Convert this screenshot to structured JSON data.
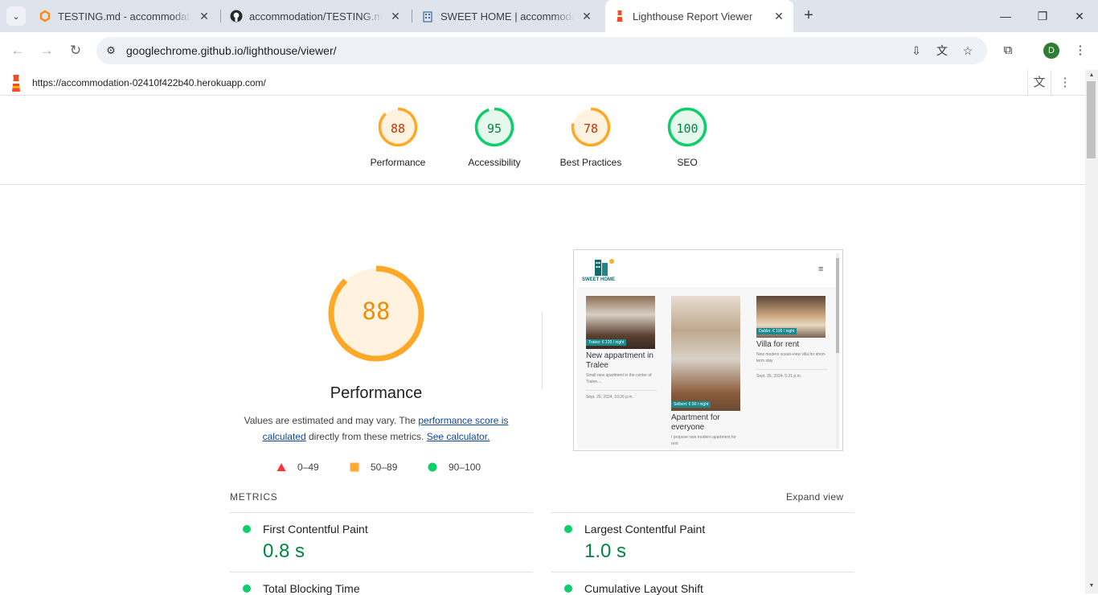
{
  "browser": {
    "tabs": [
      {
        "title": "TESTING.md - accommodation",
        "favicon": "gitpod-icon",
        "active": false
      },
      {
        "title": "accommodation/TESTING.md at",
        "favicon": "github-icon",
        "active": false
      },
      {
        "title": "SWEET HOME | accommodation",
        "favicon": "building-icon",
        "active": false
      },
      {
        "title": "Lighthouse Report Viewer",
        "favicon": "lighthouse-icon",
        "active": true
      }
    ],
    "url": "googlechrome.github.io/lighthouse/viewer/",
    "profile_initial": "D",
    "accent": "#dfe3ec"
  },
  "report": {
    "tested_url": "https://accommodation-02410f422b40.herokuapp.com/",
    "categories": [
      {
        "label": "Performance",
        "score": "88",
        "status": "average"
      },
      {
        "label": "Accessibility",
        "score": "95",
        "status": "pass"
      },
      {
        "label": "Best Practices",
        "score": "78",
        "status": "average"
      },
      {
        "label": "SEO",
        "score": "100",
        "status": "pass"
      }
    ],
    "performance": {
      "score": "88",
      "title": "Performance",
      "desc_before": "Values are estimated and may vary. The ",
      "desc_link": "performance score is calculated",
      "desc_middle": " directly from these metrics. ",
      "desc_calc": "See calculator."
    },
    "legend": [
      {
        "range": "0–49",
        "shape": "triangle",
        "color": "#ff3333"
      },
      {
        "range": "50–89",
        "shape": "square",
        "color": "#ffaa33"
      },
      {
        "range": "90–100",
        "shape": "circle",
        "color": "#0cce6b"
      }
    ],
    "metrics_heading": "METRICS",
    "expand_label": "Expand view",
    "metrics": [
      {
        "name": "First Contentful Paint",
        "value": "0.8 s"
      },
      {
        "name": "Largest Contentful Paint",
        "value": "1.0 s"
      },
      {
        "name": "Total Blocking Time",
        "value": ""
      },
      {
        "name": "Cumulative Layout Shift",
        "value": ""
      }
    ],
    "screenshot": {
      "brand": "SWEET HOME",
      "cards": [
        {
          "price": "Tralee: € 120 / night",
          "title": "New appartment in Tralee",
          "desc": "Small new apartment in the center of Tralee....",
          "date": "Sept. 26, 2024, 10:26 p.m."
        },
        {
          "price": "Selbert: € 90 / night",
          "title": "Apartment for everyone",
          "desc": "I propose new modern apartment for rent",
          "date": ""
        },
        {
          "price": "Dublin: € 195 / night",
          "title": "Villa for rent",
          "desc": "New modern ocean-view villa for short-term stay",
          "date": "Sept. 26, 2024, 5:21 p.m."
        }
      ]
    }
  }
}
